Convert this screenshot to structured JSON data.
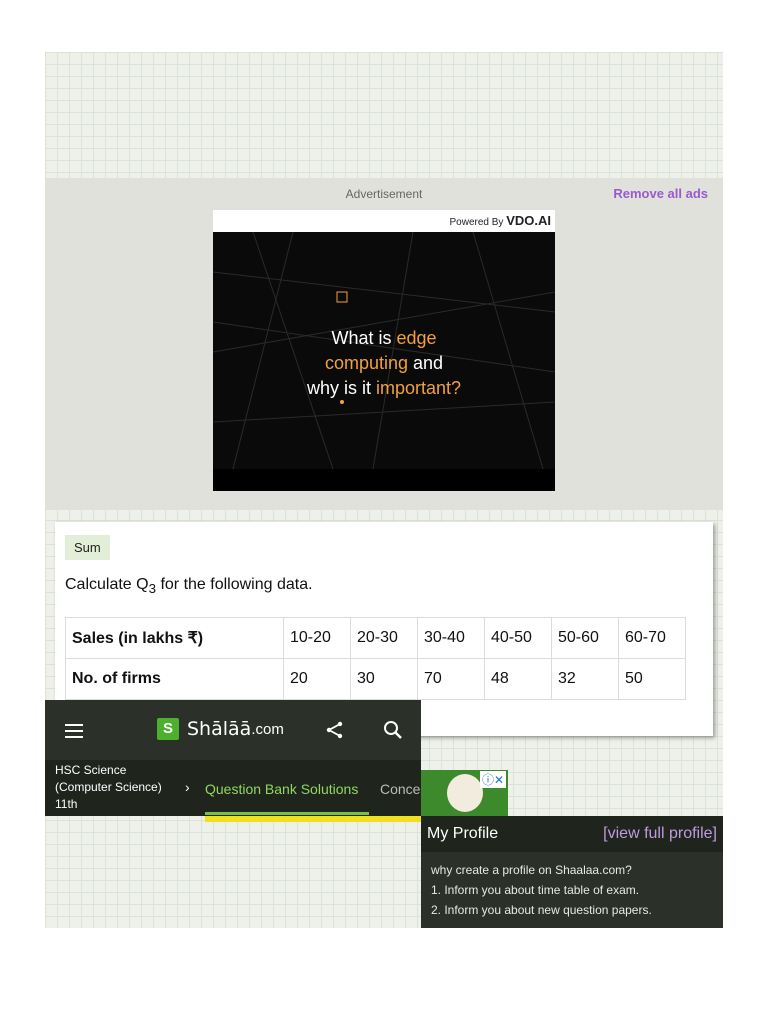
{
  "advertisement": {
    "label": "Advertisement",
    "remove_label": "Remove all ads",
    "powered_by": "Powered By",
    "brand": "VDO.AI",
    "video_text": {
      "line1_a": "What is ",
      "line1_b": "edge",
      "line2_a": "computing",
      "line2_b": " and",
      "line3_a": "why is it ",
      "line3_b": "important?"
    },
    "highlight_color": "#f0a040"
  },
  "question": {
    "tag": "Sum",
    "text_prefix": "Calculate Q",
    "text_sub": "3",
    "text_suffix": " for the following data.",
    "table": {
      "row1": {
        "label": "Sales (in lakhs ₹)",
        "cells": [
          "10-20",
          "20-30",
          "30-40",
          "40-50",
          "50-60",
          "60-70"
        ]
      },
      "row2": {
        "label": "No. of firms",
        "cells": [
          "20",
          "30",
          "70",
          "48",
          "32",
          "50"
        ]
      }
    }
  },
  "navbar": {
    "logo_letter": "S",
    "logo_text": "Shālāā",
    "logo_suffix": ".com",
    "icons": [
      "menu-icon",
      "share-icon",
      "search-icon"
    ]
  },
  "breadcrumb": {
    "course_line1": "HSC Science",
    "course_line2": "(Computer Science)",
    "course_line3": "11th",
    "separator": "›",
    "active": "Question Bank Solutions",
    "next": "Conce"
  },
  "profile": {
    "title": "My Profile",
    "link": "[view full profile]",
    "line1": "why create a profile on Shaalaa.com?",
    "line2": "1. Inform you about time table of exam.",
    "line3": "2. Inform you about new question papers."
  },
  "colors": {
    "brand_green": "#4caf2e",
    "nav_dark": "#2b3028",
    "active_link": "#90d860",
    "remove_ads": "#9b59d0"
  }
}
